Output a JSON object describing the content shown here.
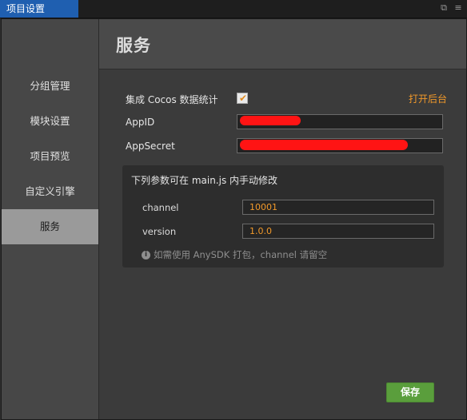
{
  "window": {
    "tab_title": "项目设置"
  },
  "sidebar": {
    "items": [
      {
        "label": "分组管理",
        "active": false
      },
      {
        "label": "模块设置",
        "active": false
      },
      {
        "label": "项目预览",
        "active": false
      },
      {
        "label": "自定义引擎",
        "active": false
      },
      {
        "label": "服务",
        "active": true
      }
    ]
  },
  "main": {
    "title": "服务",
    "integrate_label": "集成 Cocos 数据统计",
    "integrate_checked": true,
    "open_backend_link": "打开后台",
    "appid_label": "AppID",
    "appid_value": "",
    "appsecret_label": "AppSecret",
    "appsecret_value": "",
    "panel": {
      "title": "下列参数可在 main.js 内手动修改",
      "channel_label": "channel",
      "channel_value": "10001",
      "version_label": "version",
      "version_value": "1.0.0",
      "hint": "如需使用 AnySDK 打包，channel 请留空"
    },
    "save_label": "保存"
  },
  "colors": {
    "accent": "#f1992a",
    "tab_blue": "#1f5fb0",
    "save_green": "#5a9e3c",
    "redaction": "#ff1414"
  },
  "icons": [
    "restore-icon",
    "menu-icon",
    "checkmark-icon",
    "info-icon"
  ]
}
